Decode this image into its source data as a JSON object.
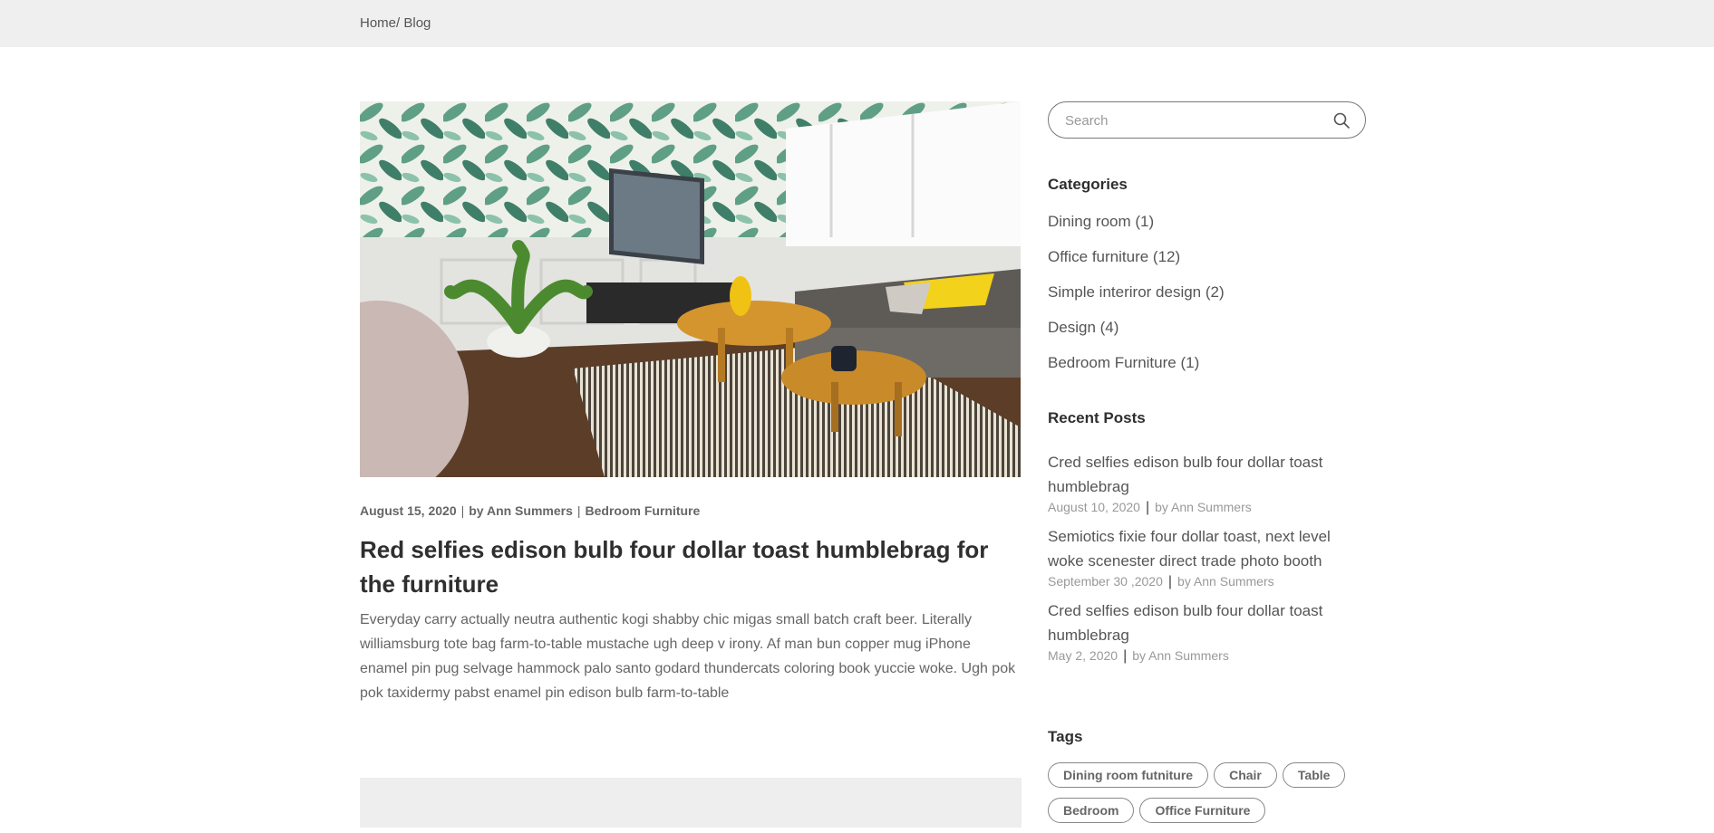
{
  "breadcrumb": {
    "home": "Home/",
    "current": " Blog"
  },
  "post": {
    "date": "August 15, 2020",
    "author": "by Ann Summers",
    "category": "Bedroom Furniture",
    "separator": "|",
    "title": "Red selfies edison bulb four dollar toast humblebrag for the furniture",
    "excerpt": "Everyday carry actually neutra authentic kogi shabby chic migas small batch craft beer. Literally williamsburg tote bag farm-to-table mustache ugh deep v irony. Af man bun copper mug iPhone enamel pin pug selvage hammock palo santo godard thundercats coloring book yuccie woke. Ugh pok pok taxidermy pabst enamel pin edison bulb farm-to-table"
  },
  "search": {
    "placeholder": "Search",
    "icon": "search-icon"
  },
  "categories": {
    "heading": "Categories",
    "items": [
      "Dining room (1)",
      "Office furniture (12)",
      "Simple interiror design (2)",
      "Design (4)",
      "Bedroom Furniture (1)"
    ]
  },
  "recent_posts": {
    "heading": "Recent Posts",
    "items": [
      {
        "title": "Cred selfies edison bulb four dollar toast humblebrag",
        "date": "August 10, 2020",
        "author": "by Ann Summers"
      },
      {
        "title": "Semiotics fixie four dollar toast, next level woke scenester direct trade photo booth",
        "date": "September 30 ,2020",
        "author": "by Ann Summers"
      },
      {
        "title": "Cred selfies edison bulb four dollar toast humblebrag",
        "date": "May 2, 2020",
        "author": "by Ann Summers"
      }
    ],
    "separator": "|"
  },
  "tags": {
    "heading": "Tags",
    "items": [
      "Dining room futniture",
      "Chair",
      "Table",
      "Bedroom",
      "Office Furniture"
    ]
  },
  "colors": {
    "topbar": "#efefef",
    "heading": "#2f2f2f",
    "text": "#555555",
    "muted": "#999999",
    "sofa_pillow": "#f2d21b"
  }
}
